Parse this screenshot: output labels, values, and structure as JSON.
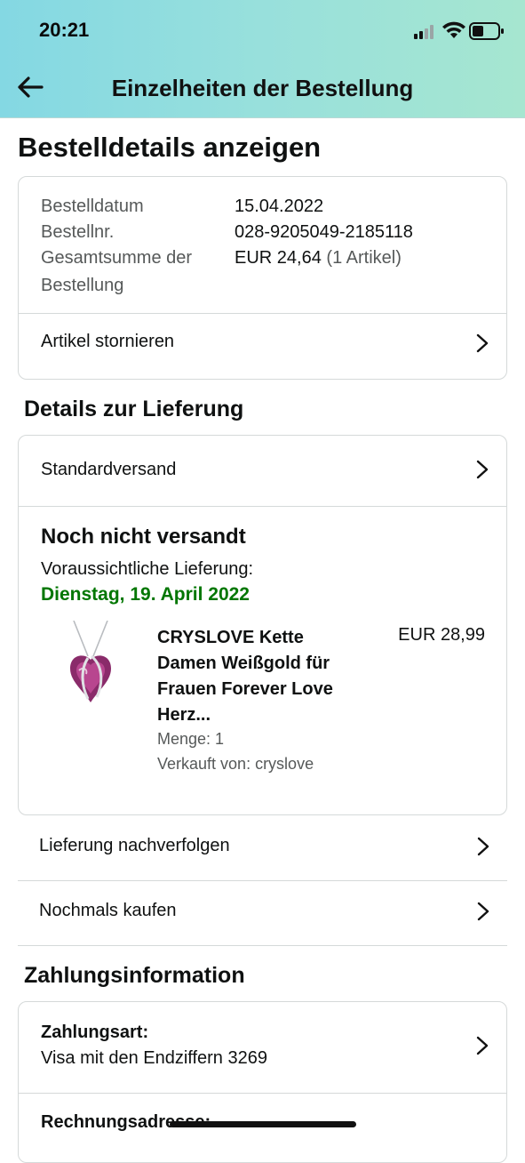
{
  "status_bar": {
    "time": "20:21"
  },
  "nav": {
    "title": "Einzelheiten der Bestellung"
  },
  "page": {
    "title": "Bestelldetails anzeigen"
  },
  "order_summary": {
    "date_label": "Bestelldatum",
    "date_value": "15.04.2022",
    "number_label": "Bestellnr.",
    "number_value": "028-9205049-2185118",
    "total_label_line1": "Gesamtsumme der",
    "total_label_line2": "Bestellung",
    "total_value": "EUR 24,64",
    "total_items": "(1 Artikel)",
    "cancel_label": "Artikel stornieren"
  },
  "delivery": {
    "section_title": "Details zur Lieferung",
    "shipping_method": "Standardversand",
    "status": "Noch nicht versandt",
    "expected_label": "Voraussichtliche Lieferung:",
    "expected_date": "Dienstag, 19. April 2022",
    "item": {
      "title_lines": [
        "CRYSLOVE Kette",
        "Damen Weißgold für",
        "Frauen Forever Love",
        "Herz..."
      ],
      "price": "EUR 28,99",
      "quantity": "Menge: 1",
      "seller": "Verkauft von: cryslove"
    }
  },
  "actions": {
    "track": "Lieferung nachverfolgen",
    "buy_again": "Nochmals kaufen"
  },
  "payment": {
    "section_title": "Zahlungsinformation",
    "method_label": "Zahlungsart:",
    "method_value": "Visa mit den Endziffern 3269",
    "billing_label": "Rechnungsadresse:"
  },
  "colors": {
    "header_gradient_start": "#84d8e3",
    "header_gradient_end": "#a6e6d0",
    "delivery_date_green": "#007600",
    "border": "#d5d9d9",
    "muted_text": "#565959"
  },
  "icons": {
    "back": "arrow-left-icon",
    "chevron": "chevron-right-icon",
    "signal": "cellular-signal-icon",
    "wifi": "wifi-icon",
    "battery": "battery-icon"
  }
}
